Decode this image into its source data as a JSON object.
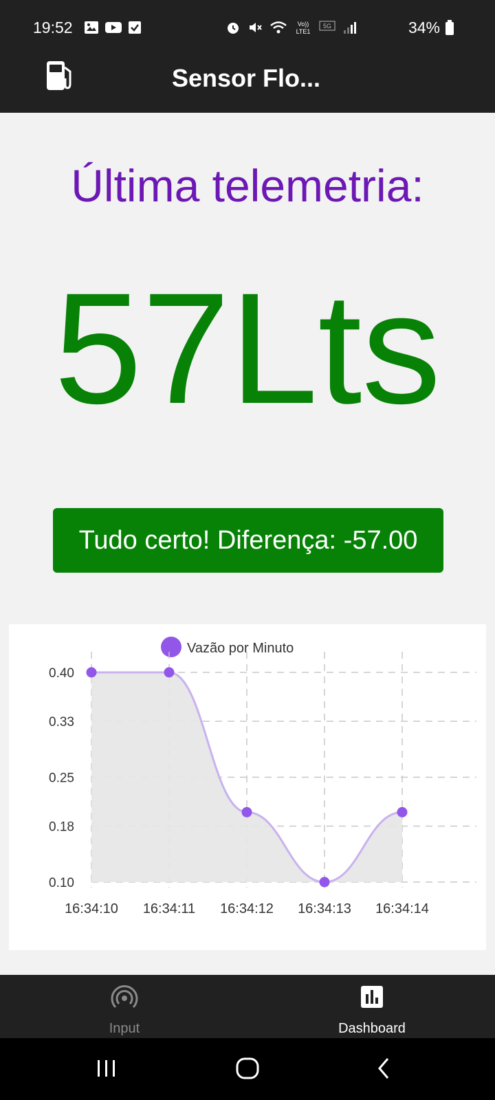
{
  "status_bar": {
    "time": "19:52",
    "battery": "34%",
    "left_icons": [
      "gallery-icon",
      "youtube-icon",
      "check-icon"
    ],
    "right_icons": [
      "alarm-icon",
      "mute-icon",
      "wifi-icon",
      "volte-icon",
      "5g-icon",
      "signal-icon",
      "battery-icon"
    ]
  },
  "app_bar": {
    "title": "Sensor Flo...",
    "icon": "fuel-pump-icon"
  },
  "main": {
    "headline": "Última telemetria:",
    "value": "57Lts",
    "status_message": "Tudo certo! Diferença: -57.00"
  },
  "chart_data": {
    "type": "line",
    "legend": "Vazão por Minuto",
    "legend_placement": "top",
    "series": [
      {
        "name": "Vazão por Minuto",
        "values": [
          0.4,
          0.4,
          0.2,
          0.1,
          0.2
        ]
      }
    ],
    "categories": [
      "16:34:10",
      "16:34:11",
      "16:34:12",
      "16:34:13",
      "16:34:14"
    ],
    "y_ticks": [
      "0.40",
      "0.33",
      "0.25",
      "0.18",
      "0.10"
    ],
    "ylim": [
      0.1,
      0.4
    ],
    "grid": true,
    "filled": true,
    "colors": {
      "line": "#c9b2ee",
      "point": "#9256e9",
      "fill": "#e6e6e6",
      "grid": "#c8c8c8"
    }
  },
  "bottom_nav": {
    "items": [
      {
        "label": "Input",
        "icon": "broadcast-icon",
        "active": false
      },
      {
        "label": "Dashboard",
        "icon": "bar-chart-icon",
        "active": true
      }
    ]
  },
  "system_nav": [
    "recents-icon",
    "home-icon",
    "back-icon"
  ],
  "colors": {
    "headline": "#6c18b4",
    "value": "#078207",
    "status_button": "#078207",
    "bars": "#212121"
  }
}
